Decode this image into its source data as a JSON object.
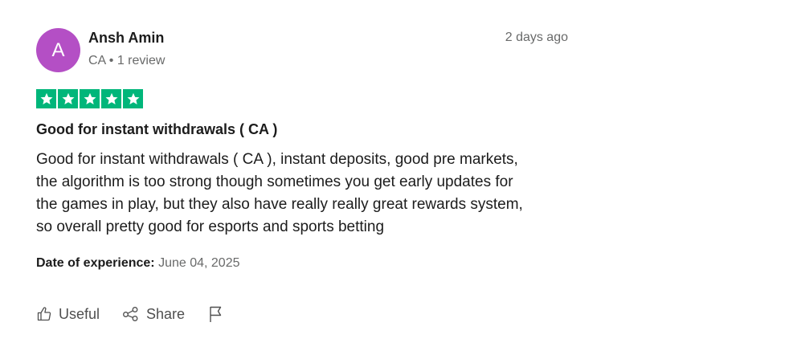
{
  "reviewer": {
    "initial": "A",
    "name": "Ansh Amin",
    "meta": "CA • 1 review",
    "avatar_color": "#b44fc5"
  },
  "review": {
    "posted": "2 days ago",
    "rating": 5,
    "star_color": "#00b67a",
    "title": "Good for instant withdrawals ( CA )",
    "body_lines": [
      "Good for instant withdrawals ( CA ), instant deposits, good pre markets,",
      "the algorithm is too strong though sometimes you get early updates for",
      "the games in play, but they also have really really great rewards system,",
      "so overall pretty good for esports and sports betting"
    ],
    "experience_label": "Date of experience:",
    "experience_date": "June 04, 2025"
  },
  "actions": {
    "useful_label": "Useful",
    "share_label": "Share",
    "useful_icon": "thumbs-up-icon",
    "share_icon": "share-icon",
    "report_icon": "flag-icon"
  }
}
